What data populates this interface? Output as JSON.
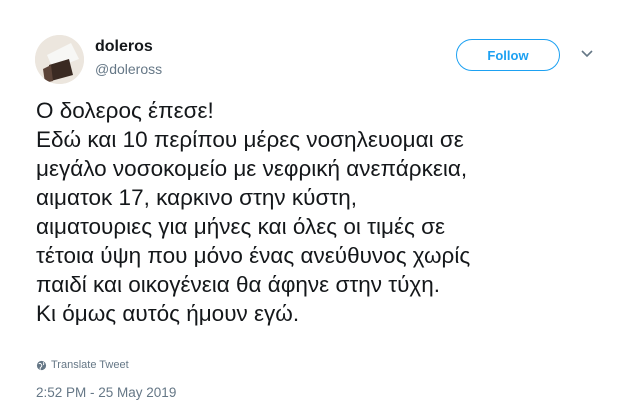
{
  "user": {
    "display_name": "doleros",
    "handle": "@doleross"
  },
  "follow_button": {
    "label": "Follow"
  },
  "tweet": {
    "lines": [
      "Ο δολερος έπεσε!",
      "Εδώ και 10 περίπου μέρες νοσηλευομαι σε",
      "μεγάλο νοσοκομείο με νεφρική ανεπάρκεια,",
      "αιματοκ 17, καρκινο στην κύστη,",
      "αιματουριες για μήνες και όλες οι τιμές σε",
      "τέτοια ύψη που μόνο ένας ανεύθυνος χωρίς",
      "παιδί και οικογένεια θα άφηνε στην τύχη.",
      "Κι όμως αυτός ήμουν εγώ."
    ]
  },
  "translate": {
    "label": "Translate Tweet",
    "icon": "globe-icon"
  },
  "timestamp": "2:52 PM - 25 May 2019",
  "colors": {
    "accent": "#1da1f2",
    "text": "#14171a",
    "muted": "#657786"
  }
}
